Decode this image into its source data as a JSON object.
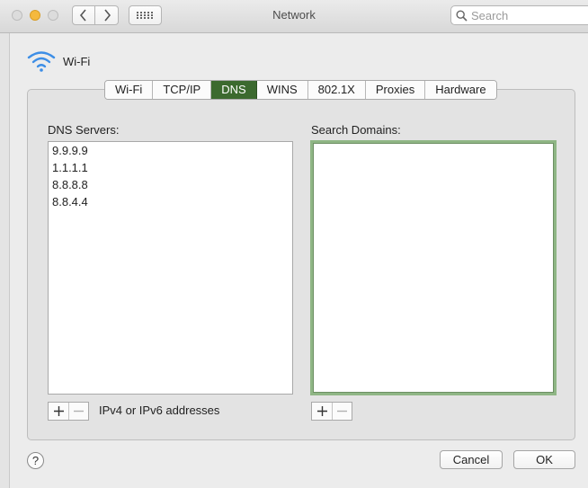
{
  "window": {
    "title": "Network"
  },
  "search": {
    "placeholder": "Search",
    "value": ""
  },
  "interface": {
    "name": "Wi-Fi",
    "icon": "wifi-icon"
  },
  "tabs": [
    {
      "label": "Wi-Fi",
      "active": false
    },
    {
      "label": "TCP/IP",
      "active": false
    },
    {
      "label": "DNS",
      "active": true
    },
    {
      "label": "WINS",
      "active": false
    },
    {
      "label": "802.1X",
      "active": false
    },
    {
      "label": "Proxies",
      "active": false
    },
    {
      "label": "Hardware",
      "active": false
    }
  ],
  "dns": {
    "label": "DNS Servers:",
    "servers": [
      "9.9.9.9",
      "1.1.1.1",
      "8.8.8.8",
      "8.8.4.4"
    ],
    "hint": "IPv4 or IPv6 addresses"
  },
  "search_domains": {
    "label": "Search Domains:",
    "items": []
  },
  "footer": {
    "help": "?",
    "cancel": "Cancel",
    "ok": "OK"
  },
  "colors": {
    "active_tab": "#3c6a2f",
    "focus_ring": "#8fb685",
    "wifi_icon": "#3d8ee6"
  }
}
